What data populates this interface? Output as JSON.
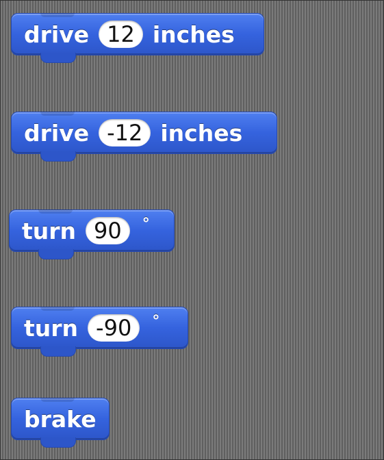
{
  "palette": {
    "block_blue": "#3563de",
    "canvas_gray": "#6e6e6e",
    "slot_white": "#ffffff"
  },
  "blocks": [
    {
      "label": "drive",
      "value": "12",
      "suffix": "inches"
    },
    {
      "label": "drive",
      "value": "-12",
      "suffix": "inches"
    },
    {
      "label": "turn",
      "value": "90",
      "suffix": "°"
    },
    {
      "label": "turn",
      "value": "-90",
      "suffix": "°"
    },
    {
      "label": "brake"
    }
  ]
}
